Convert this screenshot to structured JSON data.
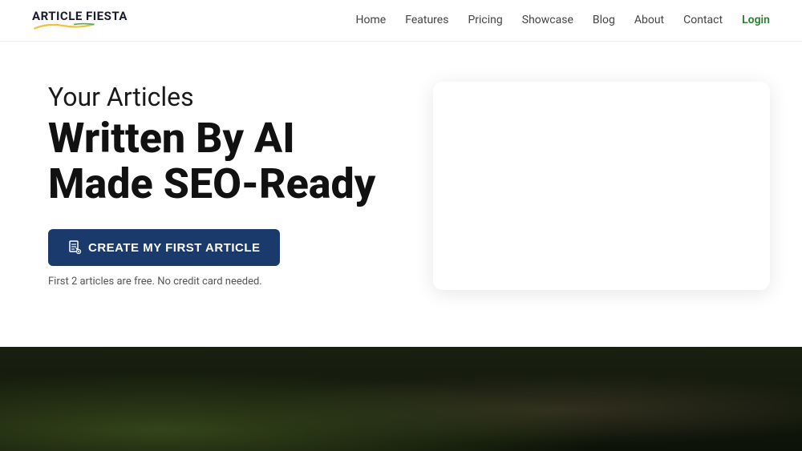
{
  "brand": {
    "name": "ARTICLE FIESTA"
  },
  "nav": {
    "items": [
      {
        "label": "Home",
        "id": "home"
      },
      {
        "label": "Features",
        "id": "features"
      },
      {
        "label": "Pricing",
        "id": "pricing"
      },
      {
        "label": "Showcase",
        "id": "showcase"
      },
      {
        "label": "Blog",
        "id": "blog"
      },
      {
        "label": "About",
        "id": "about"
      },
      {
        "label": "Contact",
        "id": "contact"
      },
      {
        "label": "Login",
        "id": "login"
      }
    ]
  },
  "hero": {
    "subtitle": "Your Articles",
    "title": "Written By AI Made SEO-Ready",
    "cta_button": "CREATE MY FIRST ARTICLE",
    "cta_note": "First 2 articles are free. No credit card needed."
  }
}
